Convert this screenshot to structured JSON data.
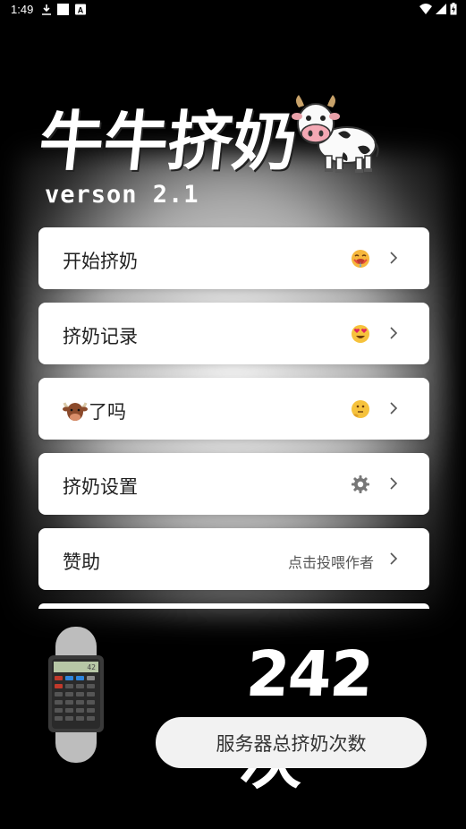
{
  "status_bar": {
    "time": "1:49",
    "icons": [
      "download-icon",
      "notification-square-icon",
      "app-a-icon",
      "wifi-icon",
      "cellular-icon",
      "battery-charging-icon"
    ]
  },
  "header": {
    "title": "牛牛挤奶",
    "version": "verson 2.1",
    "mascot_icon": "cow-icon"
  },
  "menu": {
    "items": [
      {
        "label": "开始挤奶",
        "right_icon": "drooling-face-icon",
        "right_text": ""
      },
      {
        "label": "挤奶记录",
        "right_icon": "heart-eyes-face-icon",
        "right_text": ""
      },
      {
        "label": "了吗",
        "left_icon": "ox-face-icon",
        "right_icon": "thinking-face-icon",
        "right_text": ""
      },
      {
        "label": "挤奶设置",
        "right_icon": "gear-icon",
        "right_text": ""
      },
      {
        "label": "赞助",
        "right_text": "点击投喂作者"
      }
    ]
  },
  "stats": {
    "count": "242次",
    "caption": "服务器总挤奶次数",
    "watch_icon": "calculator-watch-icon"
  },
  "colors": {
    "background": "#000000",
    "card": "#ffffff",
    "pill": "#f2f2f2"
  }
}
